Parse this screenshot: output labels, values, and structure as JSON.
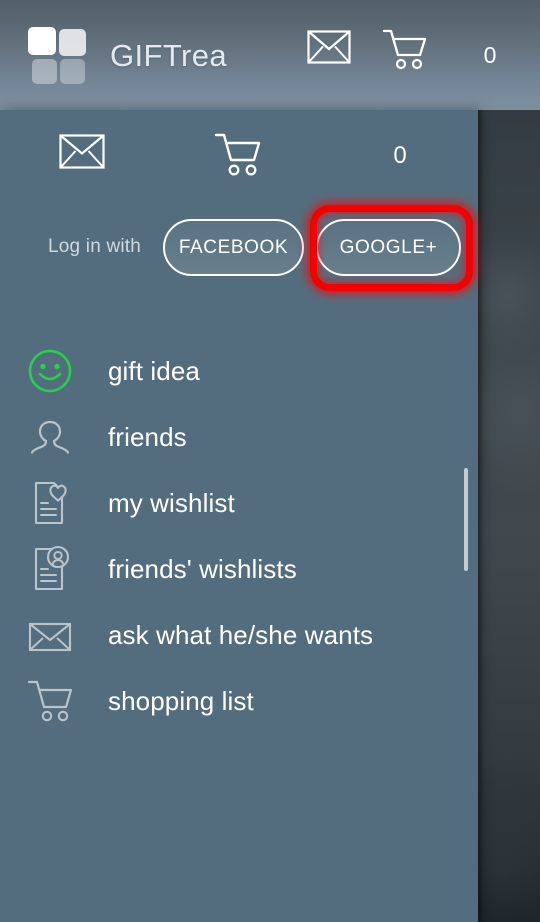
{
  "app": {
    "brand": "GIFTrea",
    "logo_icon": "four-squares-logo"
  },
  "header": {
    "mail_icon": "envelope-icon",
    "cart_icon": "shopping-cart-icon",
    "cart_count": "0"
  },
  "drawer": {
    "mail_icon": "envelope-icon",
    "cart_icon": "shopping-cart-icon",
    "cart_count": "0",
    "login": {
      "label": "Log in with",
      "buttons": [
        {
          "label": "FACEBOOK",
          "name": "facebook"
        },
        {
          "label": "GOOGLE+",
          "name": "google-plus"
        }
      ]
    },
    "menu": [
      {
        "label": "gift idea",
        "icon": "smiley-face-icon",
        "accent": "#24d24a"
      },
      {
        "label": "friends",
        "icon": "person-icon",
        "accent": "#c3ccd2"
      },
      {
        "label": "my wishlist",
        "icon": "document-heart-icon",
        "accent": "#c3ccd2"
      },
      {
        "label": "friends' wishlists",
        "icon": "document-person-icon",
        "accent": "#c3ccd2"
      },
      {
        "label": "ask what he/she wants",
        "icon": "envelope-icon",
        "accent": "#c3ccd2"
      },
      {
        "label": "shopping list",
        "icon": "shopping-cart-icon",
        "accent": "#c3ccd2"
      }
    ]
  },
  "annotation": {
    "target": "GOOGLE+",
    "color": "#f50000"
  },
  "colors": {
    "drawer_bg": "#546d7e",
    "appbar_top": "#525f6b",
    "appbar_bottom": "#7d8f9f",
    "scrim": "#3d464b",
    "accent_green": "#24d24a",
    "highlight_red": "#f50000"
  }
}
